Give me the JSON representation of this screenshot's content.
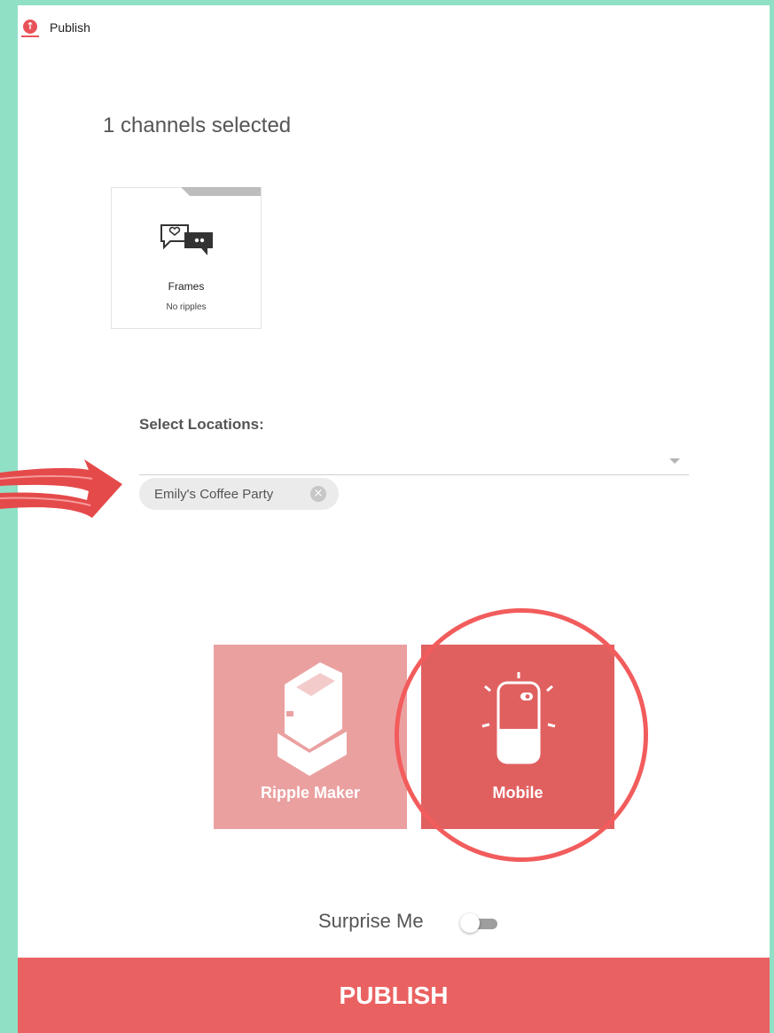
{
  "app": {
    "icon": "upload-arrow-icon",
    "title": "Publish"
  },
  "channels": {
    "heading": "1 channels selected",
    "items": [
      {
        "name": "Frames",
        "status": "No ripples",
        "icon": "chat-bubbles-icon"
      }
    ]
  },
  "locations": {
    "label": "Select Locations:",
    "selected": [
      {
        "label": "Emily's Coffee Party",
        "remove_icon": "close-circle-icon"
      }
    ]
  },
  "targets": [
    {
      "label": "Ripple Maker",
      "icon": "ripple-maker-device-icon",
      "selected": false,
      "color": "#eba0a0"
    },
    {
      "label": "Mobile",
      "icon": "mobile-phone-icon",
      "selected": true,
      "color": "#e06060"
    }
  ],
  "surprise_me": {
    "label": "Surprise Me",
    "enabled": false
  },
  "publish_button": {
    "label": "PUBLISH",
    "color": "#ea6162"
  },
  "colors": {
    "background": "#90e0c6",
    "accent": "#ea6162",
    "annotation": "#f25c5c"
  }
}
